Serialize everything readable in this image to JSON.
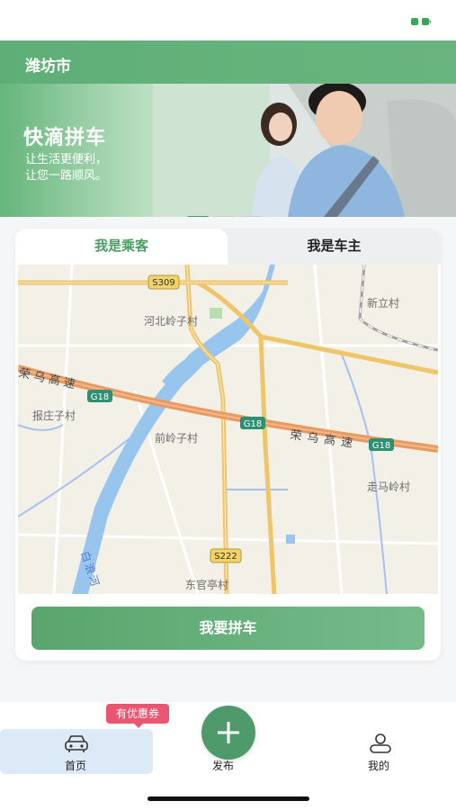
{
  "header": {
    "city": "潍坊市"
  },
  "banner": {
    "title": "快滴拼车",
    "subtitle_line1": "让生活更便利，",
    "subtitle_line2": "让您一路顺风。"
  },
  "tabs": [
    {
      "label": "我是乘客",
      "active": true
    },
    {
      "label": "我是车主",
      "active": false
    }
  ],
  "map": {
    "labels": {
      "s309": "S309",
      "hebei": "河北岭子村",
      "xinli": "新立村",
      "rongwu1": "荣乌高速",
      "g18a": "G18",
      "baozhuang": "报庄子村",
      "g18b": "G18",
      "qianling": "前岭子村",
      "rongwu2": "荣乌高速",
      "g18c": "G18",
      "zouma": "走马岭村",
      "bailang": "白浪河",
      "s222": "S222",
      "dongguan": "东官亭村"
    }
  },
  "cta": {
    "label": "我要拼车"
  },
  "tabbar": {
    "coupon": "有优惠券",
    "home": "首页",
    "publish": "发布",
    "mine": "我的"
  },
  "colors": {
    "accent": "#4a9d65",
    "coupon": "#e85672",
    "highway": "#e89a62"
  }
}
